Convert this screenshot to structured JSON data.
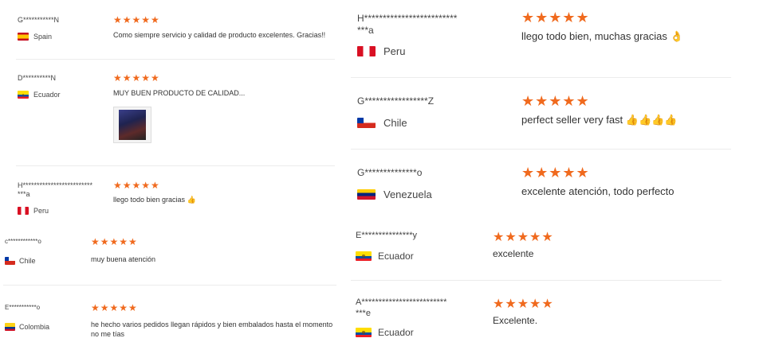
{
  "left_panel": {
    "reviews": [
      {
        "name": "G***********N",
        "country": "Spain",
        "flag": "es",
        "stars": "★★★★★",
        "text": "Como siempre servicio y calidad de producto excelentes. Gracias!!"
      },
      {
        "name": "D**********N",
        "country": "Ecuador",
        "flag": "ec",
        "stars": "★★★★★",
        "text": "MUY BUEN PRODUCTO DE CALIDAD..."
      },
      {
        "name": "H*************************\n***a",
        "country": "Peru",
        "flag": "pe",
        "stars": "★★★★★",
        "text": "llego todo bien gracias 👍"
      },
      {
        "name": "c************o",
        "country": "Chile",
        "flag": "cl",
        "stars": "★★★★★",
        "text": "muy buena atención"
      },
      {
        "name": "E***********o",
        "country": "Colombia",
        "flag": "co",
        "stars": "★★★★★",
        "text": "he hecho varios pedidos llegan rápidos y bien embalados hasta el momento no me tías"
      }
    ]
  },
  "right_panel": {
    "reviews": [
      {
        "name": "H*************************\n***a",
        "country": "Peru",
        "flag": "pe",
        "stars": "★★★★★",
        "text": "llego todo bien, muchas gracias 👌"
      },
      {
        "name": "G*****************Z",
        "country": "Chile",
        "flag": "cl",
        "stars": "★★★★★",
        "text": "perfect seller very fast 👍👍👍👍"
      },
      {
        "name": "G**************o",
        "country": "Venezuela",
        "flag": "ve",
        "stars": "★★★★★",
        "text": "excelente atención, todo perfecto"
      },
      {
        "name": "E***************y",
        "country": "Ecuador",
        "flag": "ec",
        "stars": "★★★★★",
        "text": "excelente"
      },
      {
        "name": "A*************************\n***e",
        "country": "Ecuador",
        "flag": "ec",
        "stars": "★★★★★",
        "text": "Excelente."
      }
    ]
  },
  "colors": {
    "star": "#f06a1e",
    "separator": "#ececec"
  }
}
